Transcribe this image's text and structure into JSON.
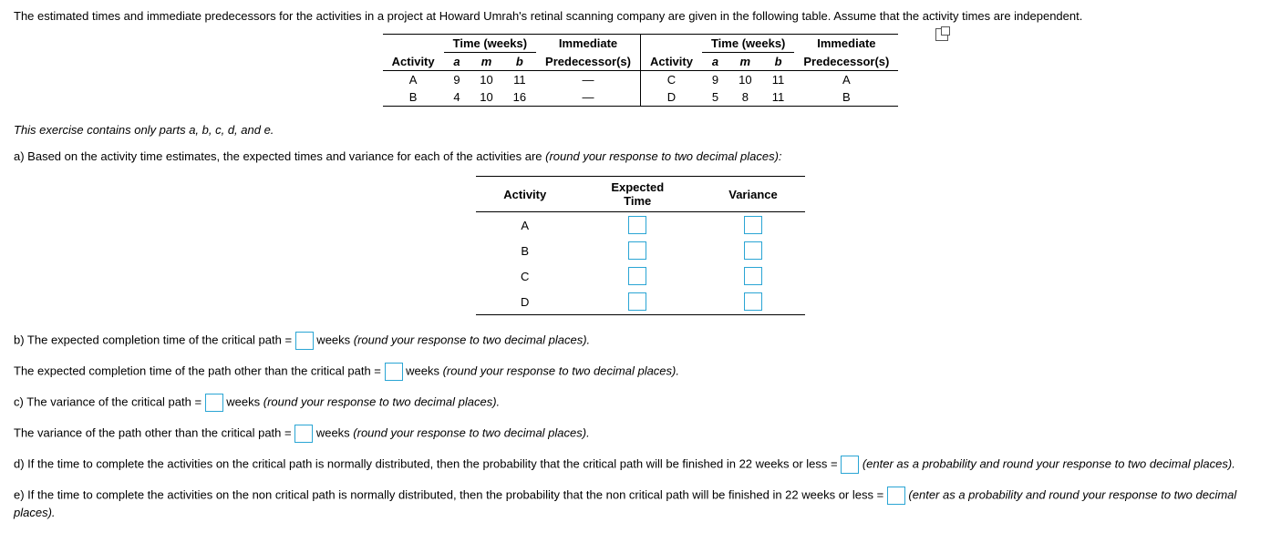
{
  "intro": "The estimated times and immediate predecessors for the activities in a project at Howard Umrah's retinal scanning company are given in the following table. Assume that the activity times are independent.",
  "table": {
    "headers": {
      "activity": "Activity",
      "time": "Time (weeks)",
      "a": "a",
      "m": "m",
      "b": "b",
      "pred": "Immediate Predecessor(s)"
    },
    "rows": [
      {
        "act": "A",
        "a": "9",
        "m": "10",
        "b": "11",
        "pred": "—"
      },
      {
        "act": "B",
        "a": "4",
        "m": "10",
        "b": "16",
        "pred": "—"
      },
      {
        "act": "C",
        "a": "9",
        "m": "10",
        "b": "11",
        "pred": "A"
      },
      {
        "act": "D",
        "a": "5",
        "m": "8",
        "b": "11",
        "pred": "B"
      }
    ]
  },
  "note": "This exercise contains only parts a, b, c, d, and e.",
  "partA": {
    "text_before": "a) Based on the activity time estimates, the expected times and variance for each of the activities are ",
    "text_italic": "(round your response to two decimal places):",
    "headers": {
      "activity": "Activity",
      "expected": "Expected Time",
      "variance": "Variance"
    },
    "acts": [
      "A",
      "B",
      "C",
      "D"
    ]
  },
  "lines": {
    "b1_before": "b) The expected completion time of the critical path = ",
    "b1_after": " weeks ",
    "b1_italic": "(round your response to two decimal places).",
    "b2_before": "The expected completion time of the path other than the critical path = ",
    "b2_after": " weeks ",
    "b2_italic": "(round your response to two decimal places).",
    "c1_before": "c) The variance of the critical path = ",
    "c1_after": " weeks ",
    "c1_italic": "(round your response to two decimal places).",
    "c2_before": "The variance of the path other than the critical path = ",
    "c2_after": " weeks ",
    "c2_italic": "(round your response to two decimal places).",
    "d_before": "d) If the time to complete the activities on the critical path is normally distributed, then the probability that the critical path will be finished in 22 weeks or less = ",
    "d_italic": " (enter as a probability and round your response to two decimal places).",
    "e_before": "e) If the time to complete the activities on the non critical path is normally distributed, then the probability that the non critical path will be finished in 22 weeks or less = ",
    "e_italic": " (enter as a probability and round your response to two decimal places)."
  }
}
